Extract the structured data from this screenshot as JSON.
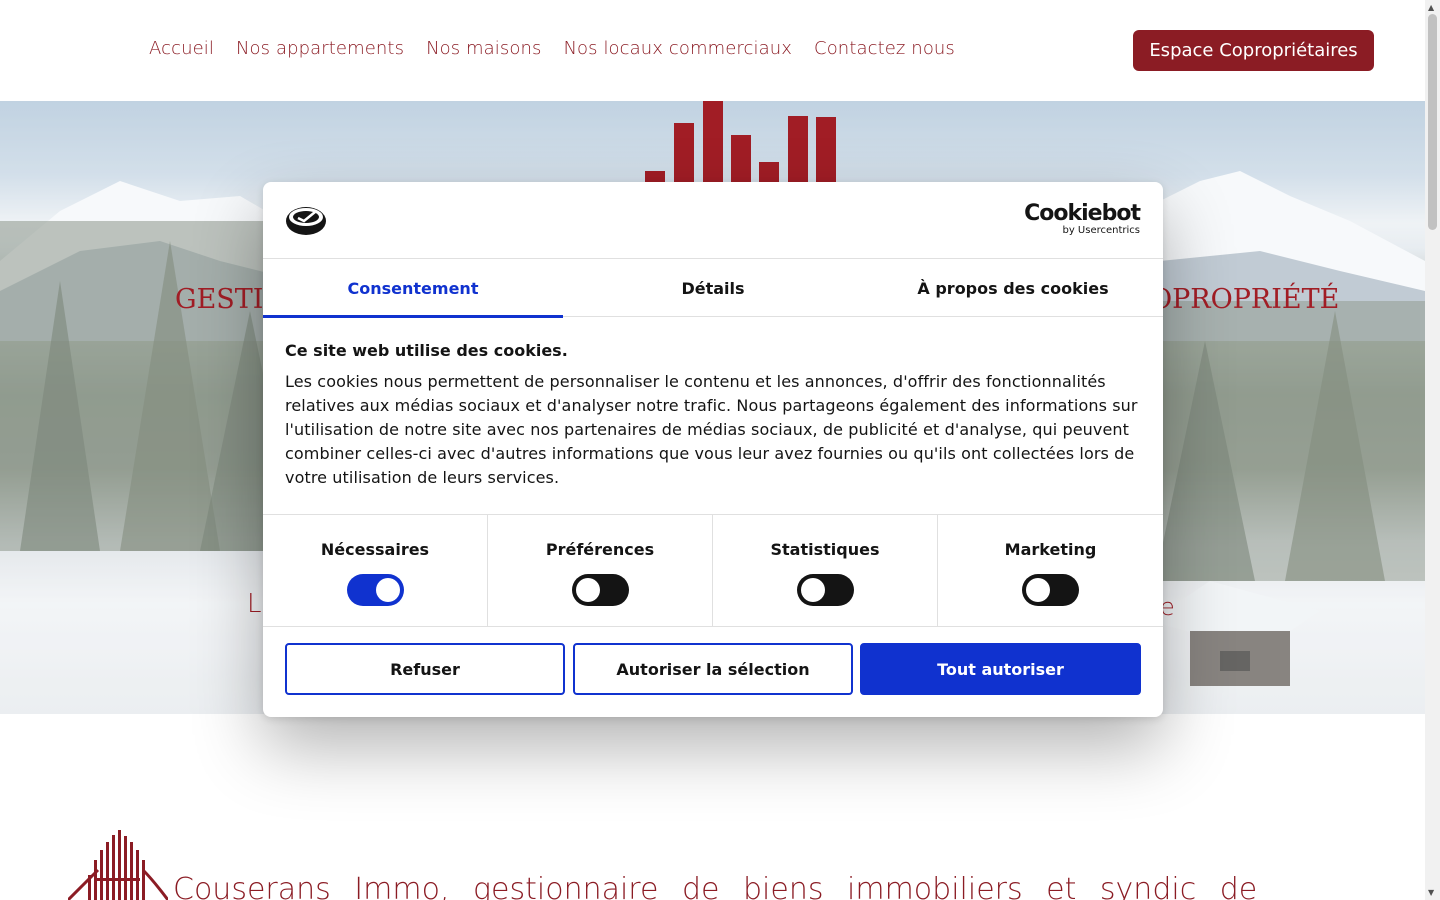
{
  "nav": {
    "items": [
      "Accueil",
      "Nos appartements",
      "Nos maisons",
      "Nos locaux commerciaux",
      "Contactez nous"
    ],
    "owner_button": "Espace Copropriétaires"
  },
  "hero": {
    "title_left": "GESTI",
    "title_right": "OPROPRIÉTÉ",
    "subtitle_left": "L",
    "subtitle_right": "e"
  },
  "cookie_dialog": {
    "brand": "Cookiebot",
    "brand_by": "by Usercentrics",
    "tabs": [
      "Consentement",
      "Détails",
      "À propos des cookies"
    ],
    "active_tab": "Consentement",
    "heading": "Ce site web utilise des cookies.",
    "body": "Les cookies nous permettent de personnaliser le contenu et les annonces, d'offrir des fonctionnalités relatives aux médias sociaux et d'analyser notre trafic. Nous partageons également des informations sur l'utilisation de notre site avec nos partenaires de médias sociaux, de publicité et d'analyse, qui peuvent combiner celles-ci avec d'autres informations que vous leur avez fournies ou qu'ils ont collectées lors de votre utilisation de leurs services.",
    "toggles": [
      {
        "label": "Nécessaires",
        "on": true
      },
      {
        "label": "Préférences",
        "on": false
      },
      {
        "label": "Statistiques",
        "on": false
      },
      {
        "label": "Marketing",
        "on": false
      }
    ],
    "buttons": {
      "refuse": "Refuser",
      "allow_selection": "Autoriser la sélection",
      "allow_all": "Tout autoriser"
    },
    "accent_color": "#1032cf"
  },
  "intro": {
    "text": "Couserans Immo, gestionnaire de biens immobiliers et syndic de"
  },
  "colors": {
    "brand": "#8b1c24",
    "text": "#141414"
  }
}
